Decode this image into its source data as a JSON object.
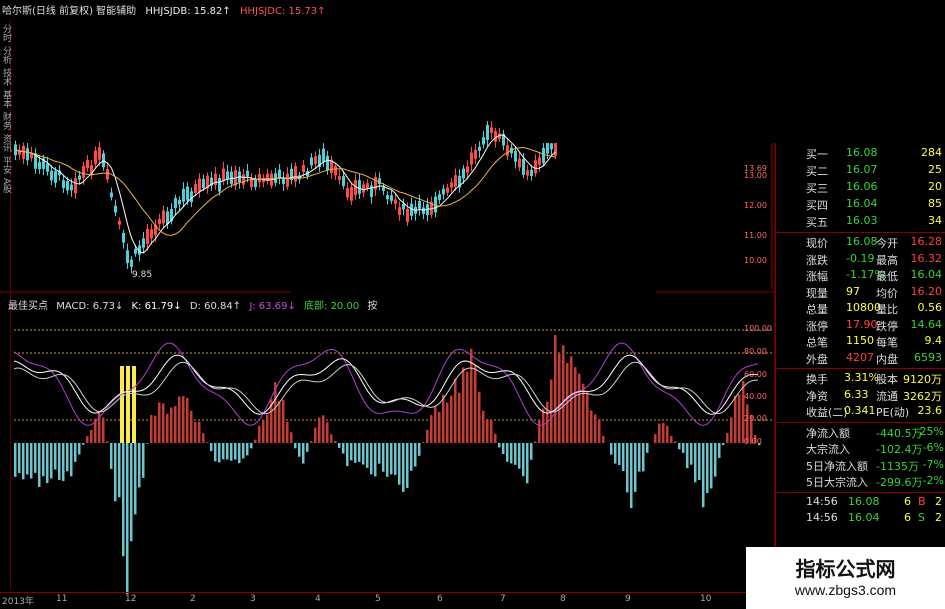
{
  "title": {
    "name": "哈尔斯(日线 前复权) 智能辅助",
    "hhjsjdb": "HHJSJDB: 15.82↑",
    "hhjsjdc": "HHJSJDC: 15.73↑"
  },
  "left_strip": [
    "分时",
    "分析",
    "技术",
    "基本",
    "财务",
    "资讯",
    "平安",
    "A股"
  ],
  "price_chart": {
    "low_marker": "9.85",
    "ylabels": [
      "13.69",
      "13.00",
      "12.00",
      "11.00",
      "10.00"
    ]
  },
  "indicator": {
    "name": "最佳买点",
    "macd": "MACD: 6.73↓",
    "k": "K: 61.79↓",
    "d": "D: 60.84↑",
    "j": "J: 63.69↓",
    "bottom": "底部: 20.00",
    "extra": "按",
    "ylabels": [
      "100.00",
      "80.00",
      "60.00",
      "40.00",
      "20.00",
      "0.00"
    ]
  },
  "order_book": [
    {
      "label": "买一",
      "price": "16.08",
      "vol": "284"
    },
    {
      "label": "买二",
      "price": "16.07",
      "vol": "25"
    },
    {
      "label": "买三",
      "price": "16.06",
      "vol": "20"
    },
    {
      "label": "买四",
      "price": "16.04",
      "vol": "85"
    },
    {
      "label": "买五",
      "price": "16.03",
      "vol": "34"
    }
  ],
  "quotes": [
    {
      "l1": "现价",
      "v1": "16.08",
      "c1": "green",
      "l2": "今开",
      "v2": "16.28",
      "c2": "red"
    },
    {
      "l1": "涨跌",
      "v1": "-0.19",
      "c1": "green",
      "l2": "最高",
      "v2": "16.32",
      "c2": "red"
    },
    {
      "l1": "涨幅",
      "v1": "-1.17%",
      "c1": "green",
      "l2": "最低",
      "v2": "16.04",
      "c2": "green"
    },
    {
      "l1": "现量",
      "v1": "97",
      "c1": "yellow",
      "l2": "均价",
      "v2": "16.20",
      "c2": "red"
    },
    {
      "l1": "总量",
      "v1": "10800",
      "c1": "yellow",
      "l2": "量比",
      "v2": "0.56",
      "c2": "yellow"
    },
    {
      "l1": "涨停",
      "v1": "17.90",
      "c1": "red",
      "l2": "跌停",
      "v2": "14.64",
      "c2": "green"
    },
    {
      "l1": "总笔",
      "v1": "1150",
      "c1": "yellow",
      "l2": "每笔",
      "v2": "9.4",
      "c2": "yellow"
    },
    {
      "l1": "外盘",
      "v1": "4207",
      "c1": "red",
      "l2": "内盘",
      "v2": "6593",
      "c2": "green"
    }
  ],
  "fundamentals": [
    {
      "l1": "换手",
      "v1": "3.31%",
      "l2": "股本",
      "v2": "9120万"
    },
    {
      "l1": "净资",
      "v1": "6.33",
      "l2": "流通",
      "v2": "3262万"
    },
    {
      "l1": "收益(二)",
      "v1": "0.341",
      "l2": "PE(动)",
      "v2": "23.6"
    }
  ],
  "flows": [
    {
      "label": "净流入额",
      "v1": "-440.5万",
      "v2": "-25%"
    },
    {
      "label": "大宗流入",
      "v1": "-102.4万",
      "v2": "-6%"
    },
    {
      "label": "5日净流入额",
      "v1": "-1135万",
      "v2": "-7%"
    },
    {
      "label": "5日大宗流入",
      "v1": "-299.6万",
      "v2": "-2%"
    }
  ],
  "ticks": [
    {
      "time": "14:56",
      "price": "16.08",
      "vol": "6",
      "side": "B",
      "n": "2"
    },
    {
      "time": "14:56",
      "price": "16.04",
      "vol": "6",
      "side": "S",
      "n": "2"
    }
  ],
  "x_axis": [
    "2013年",
    "11",
    "12",
    "2",
    "3",
    "4",
    "5",
    "6",
    "7",
    "8",
    "9",
    "10"
  ],
  "watermark": {
    "line1": "指标公式网",
    "line2": "www.zbgs3.com"
  },
  "colors": {
    "up": "#ff4a4a",
    "down": "#4fd1d9",
    "macd_up": "#c83a32",
    "macd_down": "#68c8d0",
    "k": "#ffffff",
    "d": "#cfcfcf",
    "j": "#b040d0"
  }
}
